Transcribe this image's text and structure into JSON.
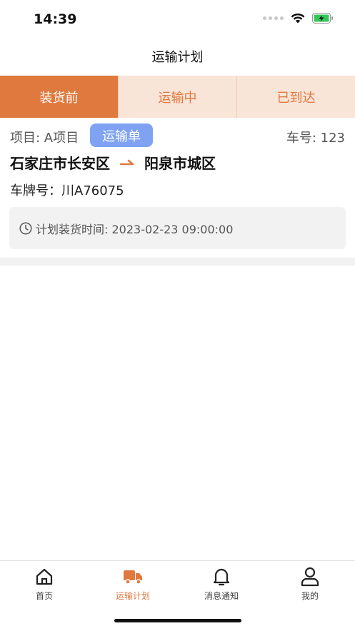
{
  "status": {
    "time": "14:39"
  },
  "nav": {
    "title": "运输计划"
  },
  "tabs": [
    {
      "label": "装货前",
      "active": true
    },
    {
      "label": "运输中",
      "active": false
    },
    {
      "label": "已到达",
      "active": false
    }
  ],
  "card": {
    "project": "项目: A项目",
    "badge": "运输单",
    "car_no": "车号: 123",
    "origin": "石家庄市长安区",
    "destination": "阳泉市城区",
    "plate": "车牌号：川A76075",
    "plan_time": "计划装货时间: 2023-02-23 09:00:00"
  },
  "tabbar": [
    {
      "label": "首页",
      "icon": "home-icon"
    },
    {
      "label": "运输计划",
      "icon": "truck-icon"
    },
    {
      "label": "消息通知",
      "icon": "bell-icon"
    },
    {
      "label": "我的",
      "icon": "user-icon"
    }
  ],
  "colors": {
    "accent": "#e0793e",
    "badge": "#7fa3f2",
    "tab_inactive_bg": "#f9e4d8"
  }
}
